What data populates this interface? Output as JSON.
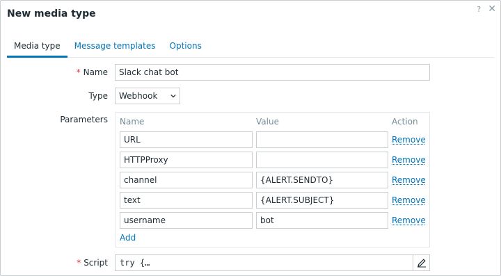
{
  "dialog": {
    "title": "New media type",
    "help_symbol": "?",
    "close_symbol": "✕"
  },
  "tabs": [
    {
      "label": "Media type",
      "active": true
    },
    {
      "label": "Message templates",
      "active": false
    },
    {
      "label": "Options",
      "active": false
    }
  ],
  "form": {
    "name_label": "Name",
    "name_value": "Slack chat bot",
    "type_label": "Type",
    "type_value": "Webhook",
    "parameters_label": "Parameters",
    "script_label": "Script",
    "script_value": "try {…",
    "required_marker": "*"
  },
  "parameters": {
    "columns": [
      "Name",
      "Value",
      "Action"
    ],
    "rows": [
      {
        "name": "URL",
        "value": "",
        "action": "Remove"
      },
      {
        "name": "HTTPProxy",
        "value": "",
        "action": "Remove"
      },
      {
        "name": "channel",
        "value": "{ALERT.SENDTO}",
        "action": "Remove"
      },
      {
        "name": "text",
        "value": "{ALERT.SUBJECT}",
        "action": "Remove"
      },
      {
        "name": "username",
        "value": "bot",
        "action": "Remove"
      }
    ],
    "add_label": "Add"
  },
  "colors": {
    "accent": "#0275b8",
    "required": "#e33734",
    "border": "#c8cdd0",
    "muted": "#768d99"
  },
  "icons": {
    "type_dropdown": "chevron-down-icon",
    "script_edit": "pencil-icon",
    "close": "close-icon",
    "help": "help-icon"
  }
}
